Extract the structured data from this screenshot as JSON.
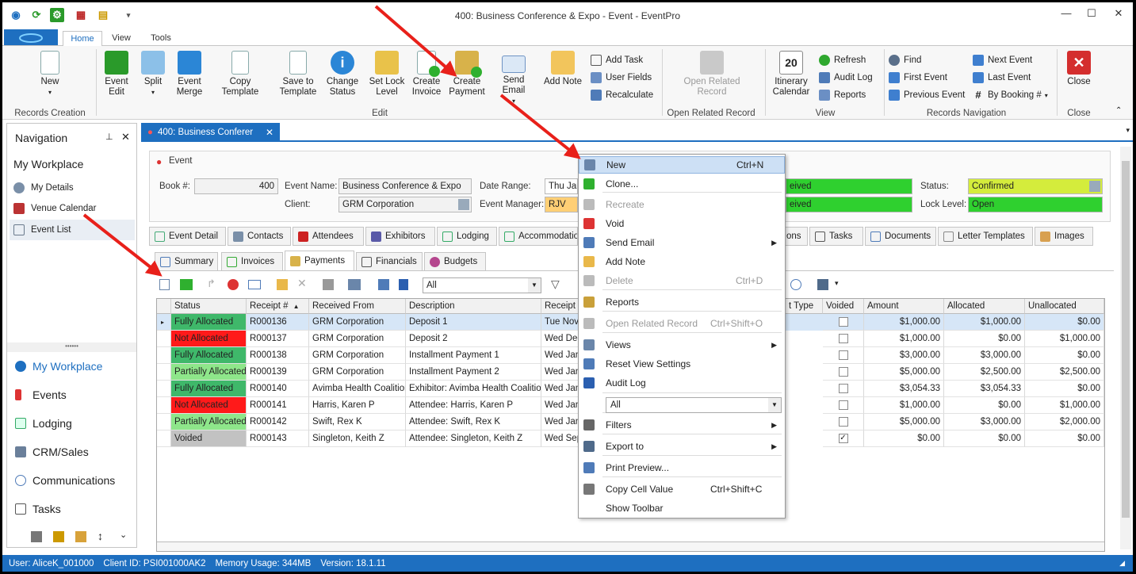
{
  "window": {
    "title": "400: Business Conference & Expo - Event - EventPro",
    "minimize": "—",
    "maximize": "☐",
    "close": "✕"
  },
  "ribbon_tabs": [
    "Home",
    "View",
    "Tools"
  ],
  "ribbon": {
    "new": "New",
    "event_edit": [
      "Event",
      "Edit"
    ],
    "split": "Split",
    "event_merge": [
      "Event",
      "Merge"
    ],
    "copy_template": "Copy Template",
    "save_to_template": [
      "Save to",
      "Template"
    ],
    "change_status": [
      "Change",
      "Status"
    ],
    "set_lock_level": [
      "Set Lock",
      "Level"
    ],
    "create_invoice": [
      "Create",
      "Invoice"
    ],
    "create_payment": [
      "Create",
      "Payment"
    ],
    "send_email": "Send Email",
    "add_note": "Add Note",
    "add_task": "Add Task",
    "user_fields": "User Fields",
    "recalculate": "Recalculate",
    "open_related_record": [
      "Open Related",
      "Record"
    ],
    "itinerary_calendar": [
      "Itinerary",
      "Calendar"
    ],
    "refresh": "Refresh",
    "audit_log": "Audit Log",
    "reports": "Reports",
    "find": "Find",
    "first_event": "First Event",
    "previous_event": "Previous Event",
    "next_event": "Next Event",
    "last_event": "Last Event",
    "by_booking": "By Booking #",
    "close": "Close",
    "groups": {
      "records_creation": "Records Creation",
      "edit": "Edit",
      "open_related_record": "Open Related Record",
      "view": "View",
      "records_navigation": "Records Navigation",
      "close": "Close"
    }
  },
  "navigation": {
    "title": "Navigation",
    "workplace_heading": "My Workplace",
    "items": [
      "My Details",
      "Venue Calendar",
      "Event List"
    ],
    "splitter": "••••••",
    "bottom": [
      "My Workplace",
      "Events",
      "Lodging",
      "CRM/Sales",
      "Communications",
      "Tasks"
    ]
  },
  "document_tab": "400: Business Conferer",
  "event": {
    "section": "Event",
    "book_label": "Book #:",
    "book_value": "400",
    "event_name_label": "Event Name:",
    "event_name_value": "Business Conference & Expo",
    "client_label": "Client:",
    "client_value": "GRM Corporation",
    "date_range_label": "Date Range:",
    "date_range_value": "Thu Jan",
    "event_manager_label": "Event Manager:",
    "event_manager_value": "RJV",
    "received_1": "eived",
    "received_2": "eived",
    "status_label": "Status:",
    "status_value": "Confirmed",
    "lock_level_label": "Lock Level:",
    "lock_level_value": "Open"
  },
  "top_tabs": [
    "Event Detail",
    "Contacts",
    "Attendees",
    "Exhibitors",
    "Lodging",
    "Accommodation",
    "ons",
    "Tasks",
    "Documents",
    "Letter Templates",
    "Images"
  ],
  "sub_tabs": [
    "Summary",
    "Invoices",
    "Payments",
    "Financials",
    "Budgets"
  ],
  "toolbar_filter": "All",
  "grid": {
    "columns": [
      "Status",
      "Receipt #",
      "Received From",
      "Description",
      "Receipt D",
      "t Type",
      "Voided",
      "Amount",
      "Allocated",
      "Unallocated"
    ],
    "rows": [
      {
        "status": "Fully Allocated",
        "receipt": "R000136",
        "from": "GRM Corporation",
        "desc": "Deposit 1",
        "date": "Tue Nov",
        "voided": false,
        "amount": "$1,000.00",
        "allocated": "$1,000.00",
        "unallocated": "$0.00"
      },
      {
        "status": "Not Allocated",
        "receipt": "R000137",
        "from": "GRM Corporation",
        "desc": "Deposit 2",
        "date": "Wed Dec",
        "voided": false,
        "amount": "$1,000.00",
        "allocated": "$0.00",
        "unallocated": "$1,000.00"
      },
      {
        "status": "Fully Allocated",
        "receipt": "R000138",
        "from": "GRM Corporation",
        "desc": "Installment Payment 1",
        "date": "Wed Jan",
        "voided": false,
        "amount": "$3,000.00",
        "allocated": "$3,000.00",
        "unallocated": "$0.00"
      },
      {
        "status": "Partially Allocated",
        "receipt": "R000139",
        "from": "GRM Corporation",
        "desc": "Installment Payment 2",
        "date": "Wed Jan",
        "voided": false,
        "amount": "$5,000.00",
        "allocated": "$2,500.00",
        "unallocated": "$2,500.00"
      },
      {
        "status": "Fully Allocated",
        "receipt": "R000140",
        "from": "Avimba Health Coalition",
        "desc": "Exhibitor: Avimba Health Coalition",
        "date": "Wed Jan",
        "voided": false,
        "amount": "$3,054.33",
        "allocated": "$3,054.33",
        "unallocated": "$0.00"
      },
      {
        "status": "Not Allocated",
        "receipt": "R000141",
        "from": "Harris, Karen P",
        "desc": "Attendee: Harris, Karen P",
        "date": "Wed Jan",
        "voided": false,
        "amount": "$1,000.00",
        "allocated": "$0.00",
        "unallocated": "$1,000.00"
      },
      {
        "status": "Partially Allocated",
        "receipt": "R000142",
        "from": "Swift, Rex K",
        "desc": "Attendee: Swift, Rex K",
        "date": "Wed Jan",
        "voided": false,
        "amount": "$5,000.00",
        "allocated": "$3,000.00",
        "unallocated": "$2,000.00"
      },
      {
        "status": "Voided",
        "receipt": "R000143",
        "from": "Singleton, Keith Z",
        "desc": "Attendee: Singleton, Keith Z",
        "date": "Wed Sep",
        "voided": true,
        "amount": "$0.00",
        "allocated": "$0.00",
        "unallocated": "$0.00"
      }
    ],
    "status_colors": {
      "Fully Allocated": "#3fb86a",
      "Not Allocated": "#ff1a1a",
      "Partially Allocated": "#8ee68a",
      "Voided": "#c2c2c2"
    }
  },
  "context_menu": [
    {
      "label": "New",
      "shortcut": "Ctrl+N",
      "highlight": true
    },
    {
      "label": "Clone..."
    },
    {
      "label": "Recreate",
      "disabled": true
    },
    {
      "label": "Void"
    },
    {
      "label": "Send Email",
      "submenu": true
    },
    {
      "label": "Add Note"
    },
    {
      "label": "Delete",
      "shortcut": "Ctrl+D",
      "disabled": true
    },
    {
      "label": "Reports"
    },
    {
      "label": "Open Related Record",
      "shortcut": "Ctrl+Shift+O",
      "disabled": true
    },
    {
      "label": "Views",
      "submenu": true
    },
    {
      "label": "Reset View Settings"
    },
    {
      "label": "Audit Log"
    },
    {
      "label": "Filters",
      "submenu": true
    },
    {
      "label": "Export to",
      "submenu": true
    },
    {
      "label": "Print Preview..."
    },
    {
      "label": "Copy Cell Value",
      "shortcut": "Ctrl+Shift+C"
    },
    {
      "label": "Show Toolbar"
    }
  ],
  "context_filter": "All",
  "status_bar": {
    "user": "User: AliceK_001000",
    "client": "Client ID: PSI001000AK2",
    "memory": "Memory Usage: 344MB",
    "version": "Version: 18.1.11"
  },
  "colors": {
    "accent": "#1e6fc0",
    "status_confirmed": "#d4ec3c",
    "lock_open": "#2fd02f",
    "received_green": "#2fd02f",
    "event_manager": "#ffcf75",
    "arrow": "#e8201a"
  }
}
